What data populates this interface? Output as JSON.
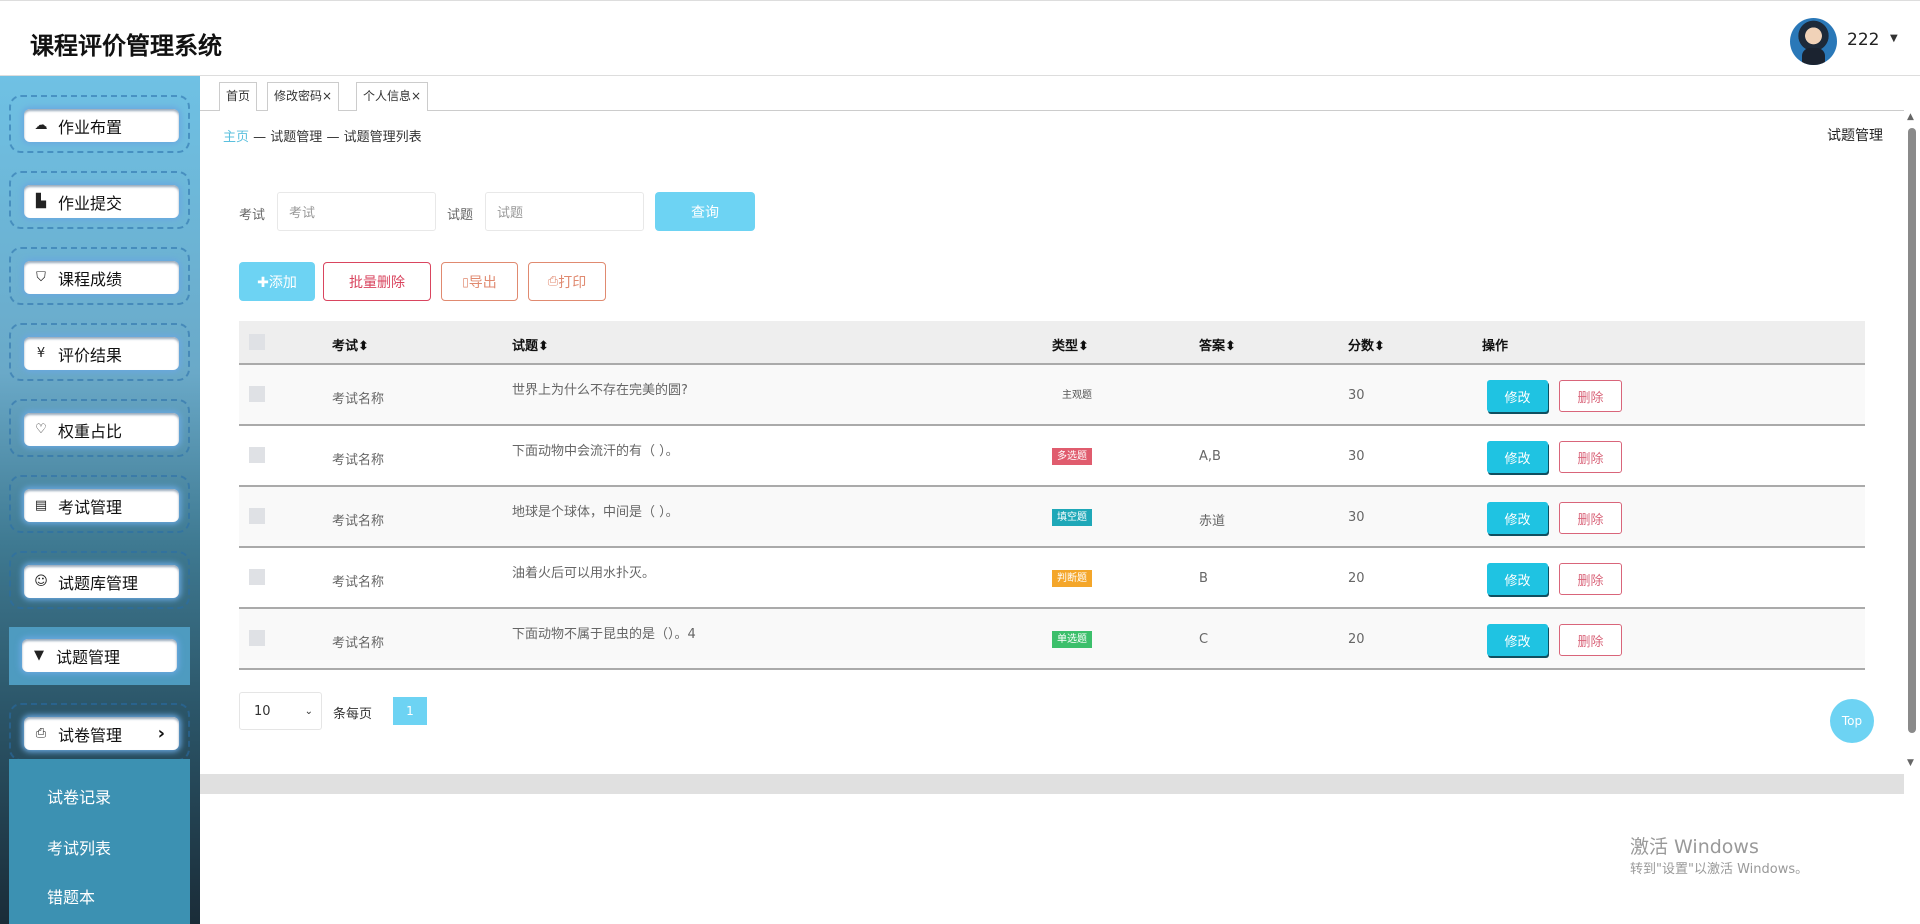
{
  "app": {
    "title": "课程评价管理系统"
  },
  "user": {
    "name": "222"
  },
  "sidebar": {
    "items": [
      {
        "label": "作业布置",
        "icon": "cloud-upload-icon",
        "glyph": "☁"
      },
      {
        "label": "作业提交",
        "icon": "bar-chart-icon",
        "glyph": "▙"
      },
      {
        "label": "课程成绩",
        "icon": "shield-check-icon",
        "glyph": "⛉"
      },
      {
        "label": "评价结果",
        "icon": "yen-document-icon",
        "glyph": "¥"
      },
      {
        "label": "权重占比",
        "icon": "heart-icon",
        "glyph": "♡"
      },
      {
        "label": "考试管理",
        "icon": "document-icon",
        "glyph": "▤"
      },
      {
        "label": "试题库管理",
        "icon": "smile-icon",
        "glyph": "☺"
      },
      {
        "label": "试题管理",
        "icon": "caret-down-icon",
        "glyph": "▼"
      },
      {
        "label": "试卷管理",
        "icon": "printer-icon",
        "glyph": "⎙"
      }
    ],
    "submenu": [
      "试卷记录",
      "考试列表",
      "错题本"
    ]
  },
  "tabs": [
    {
      "label": "首页"
    },
    {
      "label": "修改密码×"
    },
    {
      "label": "个人信息×"
    }
  ],
  "breadcrumb": {
    "home": "主页",
    "sep": "—",
    "l2": "试题管理",
    "l3": "试题管理列表"
  },
  "page_title": "试题管理",
  "search": {
    "exam_label": "考试",
    "exam_placeholder": "考试",
    "question_label": "试题",
    "question_placeholder": "试题",
    "search_btn": "查询"
  },
  "actions": {
    "add": "✚添加",
    "batch_delete": "批量删除",
    "export": "导出",
    "print": "打印"
  },
  "table": {
    "headers": {
      "exam": "考试⬍",
      "question": "试题⬍",
      "type": "类型⬍",
      "answer": "答案⬍",
      "score": "分数⬍",
      "ops": "操作"
    },
    "edit_label": "修改",
    "delete_label": "删除",
    "rows": [
      {
        "exam": "考试名称",
        "question": "世界上为什么不存在完美的圆?",
        "type": "主观题",
        "type_color": "",
        "answer": "",
        "score": "30"
      },
      {
        "exam": "考试名称",
        "question": "下面动物中会流汗的有（ ）。",
        "type": "多选题",
        "type_color": "#e05c6e",
        "answer": "A,B",
        "score": "30"
      },
      {
        "exam": "考试名称",
        "question": "地球是个球体，中间是（ ）。",
        "type": "填空题",
        "type_color": "#1fa8b8",
        "answer": "赤道",
        "score": "30"
      },
      {
        "exam": "考试名称",
        "question": "油着火后可以用水扑灭。",
        "type": "判断题",
        "type_color": "#f4a62a",
        "answer": "B",
        "score": "20"
      },
      {
        "exam": "考试名称",
        "question": "下面动物不属于昆虫的是（）。4",
        "type": "单选题",
        "type_color": "#3cbf6b",
        "answer": "C",
        "score": "20"
      }
    ]
  },
  "pagination": {
    "page_size": "10",
    "per_page_label": "条每页",
    "current_page": "1"
  },
  "top_button": "Top",
  "watermark": {
    "line1": "激活 Windows",
    "line2": "转到\"设置\"以激活 Windows。"
  }
}
